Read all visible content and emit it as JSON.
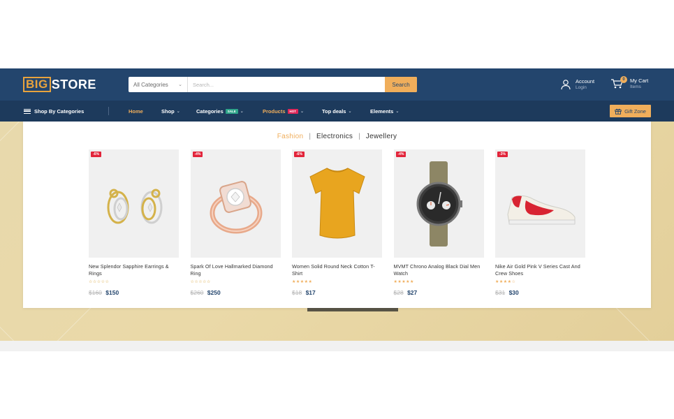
{
  "header": {
    "logo_big": "BIG",
    "logo_store": "STORE",
    "search": {
      "category": "All Categories",
      "placeholder": "Search...",
      "button": "Search"
    },
    "account": {
      "title": "Account",
      "sub": "Login"
    },
    "cart": {
      "count": "0",
      "title": "My Cart",
      "sub": "Items"
    }
  },
  "nav": {
    "categories_label": "Shop By Categories",
    "items": [
      {
        "label": "Home",
        "active": true
      },
      {
        "label": "Shop"
      },
      {
        "label": "Categories",
        "tag": "SALE"
      },
      {
        "label": "Products",
        "tag": "HOT"
      },
      {
        "label": "Top deals"
      },
      {
        "label": "Elements"
      }
    ],
    "gift": "Gift Zone"
  },
  "tabs": [
    "Fashion",
    "Electronics",
    "Jewellery"
  ],
  "products": [
    {
      "title": "New Splendor Sapphire Earrings & Rings",
      "discount": "-6%",
      "old_price": "$160",
      "price": "$150",
      "rating": 0,
      "image": "earrings-image"
    },
    {
      "title": "Spark Of Love Hallmarked Diamond Ring",
      "discount": "-4%",
      "old_price": "$260",
      "price": "$250",
      "rating": 0,
      "image": "ring-image"
    },
    {
      "title": "Women Solid Round Neck Cotton T-Shirt",
      "discount": "-6%",
      "old_price": "$18",
      "price": "$17",
      "rating": 5,
      "image": "tshirt-image"
    },
    {
      "title": "MVMT Chrono Analog Black Dial Men Watch",
      "discount": "-4%",
      "old_price": "$28",
      "price": "$27",
      "rating": 5,
      "image": "watch-image"
    },
    {
      "title": "Nike Air Gold Pink V Series Cast And Crew Shoes",
      "discount": "-3%",
      "old_price": "$31",
      "price": "$30",
      "rating": 4.5,
      "image": "shoe-image"
    }
  ],
  "colors": {
    "header_bg": "#23456d",
    "nav_bg": "#1d3a5c",
    "accent": "#f0ae5b",
    "discount": "#e2243a"
  }
}
